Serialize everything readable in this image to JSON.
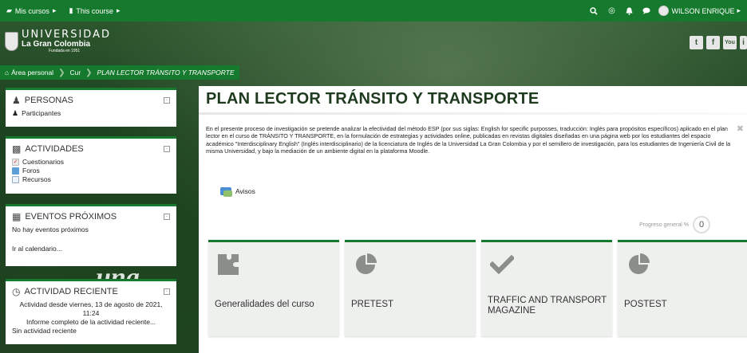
{
  "topbar": {
    "my_courses": "Mis cursos",
    "this_course": "This course",
    "user_name": "WILSON ENRIQUE"
  },
  "header": {
    "logo_line1": "UNIVERSIDAD",
    "logo_line2": "La Gran Colombia",
    "logo_line3": "Fundada en 1951",
    "social": [
      "t",
      "f",
      "You",
      "i"
    ]
  },
  "breadcrumb": {
    "home": "Área personal",
    "course": "Cur",
    "current": "PLAN LECTOR TRÁNSITO Y TRANSPORTE"
  },
  "sidebar": {
    "personas": {
      "title": "PERSONAS",
      "items": [
        "Participantes"
      ]
    },
    "actividades": {
      "title": "ACTIVIDADES",
      "items": [
        "Cuestionarios",
        "Foros",
        "Recursos"
      ]
    },
    "eventos": {
      "title": "EVENTOS PRÓXIMOS",
      "empty": "No hay eventos próximos",
      "link": "Ir al calendario..."
    },
    "reciente": {
      "title": "ACTIVIDAD RECIENTE",
      "since_line1": "Actividad desde viernes, 13 de agosto de 2021,",
      "since_line2": "11:24",
      "full_report": "Informe completo de la actividad reciente...",
      "none": "Sin actividad reciente"
    }
  },
  "background_text": "una",
  "main": {
    "title": "PLAN LECTOR TRÁNSITO Y TRANSPORTE",
    "summary": "En el presente proceso de investigación se pretende analizar la efectividad del método ESP (por sus siglas: English for specific purposses, traducción: Inglés para propósitos específicos) aplicado en el plan lector en el curso de TRÁNSITO Y TRANSPORTE, en la formulación de  estrategias y actividades online, publicadas en revistas digitales diseñadas en una página web por los estudiantes del espacio académico \"Interdisciplinary English\" (Inglés interdisciplinario) de la licenciatura de Inglés de la Universidad La Gran Colombia y por el semillero de investigación, para los estudiantes de Ingeniería Civil de la misma Universidad, y bajo la mediación de un ambiente digital en la plataforma Moodle.",
    "avisos": "Avisos",
    "progress_label": "Progreso general %",
    "progress_value": "0",
    "tiles": [
      {
        "label": "Generalidades del curso",
        "icon": "puzzle-icon"
      },
      {
        "label": "PRETEST",
        "icon": "pie-chart-icon"
      },
      {
        "label": "TRAFFIC AND TRANSPORT MAGAZINE",
        "icon": "checkmark-icon"
      },
      {
        "label": "POSTEST",
        "icon": "pie-chart-icon"
      }
    ]
  },
  "colors": {
    "brand_green": "#157a2d",
    "tile_bg": "#eef0ee"
  }
}
